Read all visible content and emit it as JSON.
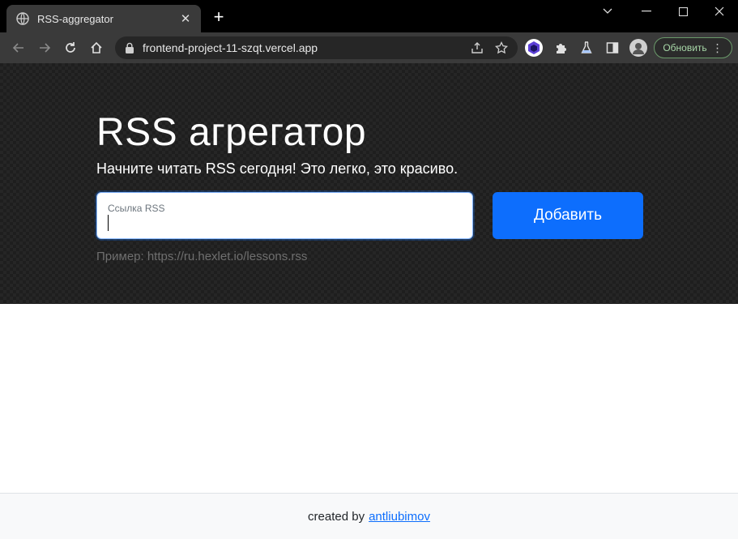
{
  "browser": {
    "tab_title": "RSS-aggregator",
    "url": "frontend-project-11-szqt.vercel.app",
    "update_label": "Обновить",
    "icons": [
      "globe-icon",
      "close-icon",
      "plus-icon",
      "chevron-down-icon",
      "minimize-icon",
      "maximize-icon",
      "window-close-icon",
      "back-icon",
      "forward-icon",
      "reload-icon",
      "home-icon",
      "lock-icon",
      "share-icon",
      "star-icon",
      "extension-hexagon-icon",
      "puzzle-icon",
      "flask-icon",
      "sidebar-icon",
      "profile-avatar-icon"
    ]
  },
  "hero": {
    "title": "RSS агрегатор",
    "lead": "Начните читать RSS сегодня! Это легко, это красиво.",
    "input_label": "Ссылка RSS",
    "input_value": "",
    "button_label": "Добавить",
    "example": "Пример: https://ru.hexlet.io/lessons.rss"
  },
  "footer": {
    "prefix": "created by",
    "author_link": "antliubimov"
  },
  "colors": {
    "primary": "#0d6efd",
    "hero_bg": "#1e1e1e",
    "footer_bg": "#f8f9fa"
  }
}
